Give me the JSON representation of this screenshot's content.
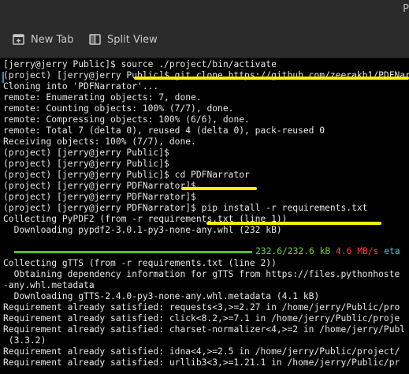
{
  "window": {
    "corner_letter": "P"
  },
  "toolbar": {
    "new_tab_label": "New Tab",
    "split_view_label": "Split View",
    "new_tab_icon": "new-tab-icon",
    "split_view_icon": "split-view-icon"
  },
  "terminal": {
    "lines": [
      "[jerry@jerry Public]$ source ./project/bin/activate",
      "(project) [jerry@jerry Public]$ git clone https://github.com/zeerakb1/PDFNarrator",
      "Cloning into 'PDFNarrator'...",
      "remote: Enumerating objects: 7, done.",
      "remote: Counting objects: 100% (7/7), done.",
      "remote: Compressing objects: 100% (6/6), done.",
      "remote: Total 7 (delta 0), reused 4 (delta 0), pack-reused 0",
      "Receiving objects: 100% (7/7), done.",
      "(project) [jerry@jerry Public]$",
      "(project) [jerry@jerry Public]$",
      "(project) [jerry@jerry Public]$ cd PDFNarrator",
      "(project) [jerry@jerry PDFNarrator]$",
      "(project) [jerry@jerry PDFNarrator]$",
      "(project) [jerry@jerry PDFNarrator]$ pip install -r requirements.txt",
      "Collecting PyPDF2 (from -r requirements.txt (line 1))",
      "  Downloading pypdf2-3.0.1-py3-none-any.whl (232 kB)",
      "",
      "Collecting gTTS (from -r requirements.txt (line 2))",
      "  Obtaining dependency information for gTTS from https://files.pythonhoste",
      "-any.whl.metadata",
      "  Downloading gTTS-2.4.0-py3-none-any.whl.metadata (4.1 kB)",
      "Requirement already satisfied: requests<3,>=2.27 in /home/jerry/Public/pro",
      "Requirement already satisfied: click<8.2,>=7.1 in /home/jerry/Public/proje",
      "Requirement already satisfied: charset-normalizer<4,>=2 in /home/jerry/Publ",
      " (3.3.2)",
      "Requirement already satisfied: idna<4,>=2.5 in /home/jerry/Public/project/",
      "Requirement already satisfied: urllib3<3,>=1.21.1 in /home/jerry/Public/pr"
    ],
    "download_progress": {
      "fraction": 1.0,
      "size_text": "232.6/232.6 kB",
      "speed_text": "4.6 MB/s",
      "eta_text": "eta"
    }
  },
  "colors": {
    "background": "#000000",
    "text": "#e6e6e6",
    "highlight_marker": "#ffef00",
    "progress_green": "#6fd23a",
    "speed_red": "#ff3c3c"
  }
}
